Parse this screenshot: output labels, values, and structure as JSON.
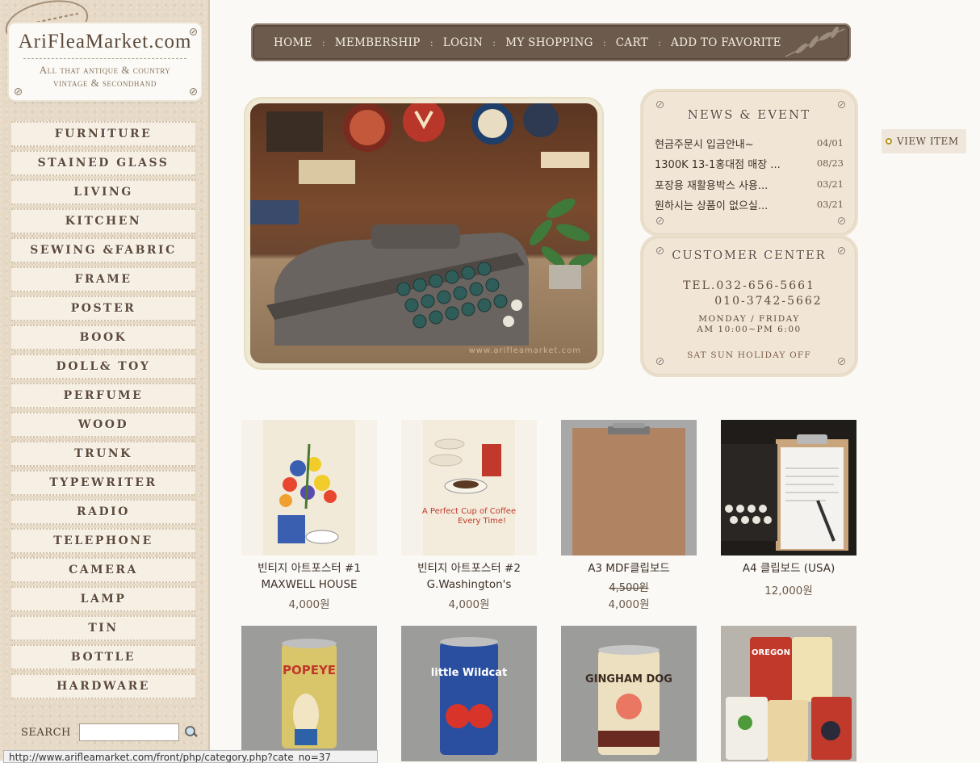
{
  "logo": {
    "title": "AriFleaMarket.com",
    "subtitle_1": "All that antique & country",
    "subtitle_2": "vintage & secondhand"
  },
  "categories": [
    "FURNITURE",
    "STAINED GLASS",
    "LIVING",
    "KITCHEN",
    "SEWING &FABRIC",
    "FRAME",
    "POSTER",
    "BOOK",
    "DOLL& TOY",
    "PERFUME",
    "WOOD",
    "TRUNK",
    "TYPEWRITER",
    "RADIO",
    "TELEPHONE",
    "CAMERA",
    "LAMP",
    "TIN",
    "BOTTLE",
    "HARDWARE"
  ],
  "search": {
    "label": "SEARCH",
    "value": ""
  },
  "nav": {
    "items": [
      "HOME",
      "MEMBERSHIP",
      "LOGIN",
      "MY SHOPPING",
      "CART",
      "ADD TO FAVORITE"
    ],
    "separator": ":"
  },
  "hero": {
    "watermark": "www.arifleamarket.com"
  },
  "news": {
    "title": "NEWS & EVENT",
    "items": [
      {
        "title": "현금주문시 입금안내~",
        "date": "04/01"
      },
      {
        "title": "1300K 13-1홍대점 매장 ...",
        "date": "08/23"
      },
      {
        "title": "포장용 재활용박스 사용...",
        "date": "03/21"
      },
      {
        "title": "원하시는 상품이 없으실...",
        "date": "03/21"
      }
    ]
  },
  "customer_center": {
    "title": "CUSTOMER CENTER",
    "tel_1": "TEL.032-656-5661",
    "tel_2": "010-3742-5662",
    "hours_1": "MONDAY / FRIDAY",
    "hours_2": "AM 10:00~PM 6:00",
    "holiday": "SAT SUN HOLIDAY OFF"
  },
  "view_item": {
    "label": "VIEW ITEM"
  },
  "products": [
    {
      "name_1": "빈티지 아트포스터 #1",
      "name_2": "MAXWELL HOUSE",
      "price": "4,000원",
      "old_price": ""
    },
    {
      "name_1": "빈티지 아트포스터 #2",
      "name_2": "G.Washington's",
      "price": "4,000원",
      "old_price": ""
    },
    {
      "name_1": "A3 MDF클립보드",
      "name_2": "",
      "price": "4,000원",
      "old_price": "4,500원"
    },
    {
      "name_1": "A4 클립보드 (USA)",
      "name_2": "",
      "price": "12,000원",
      "old_price": ""
    }
  ],
  "products_row2": [
    {
      "label": "POPEYE"
    },
    {
      "label": "little Wildcat"
    },
    {
      "label": "GINGHAM DOG"
    },
    {
      "label": "OREGON"
    }
  ],
  "statusbar": {
    "text": "http://www.arifleamarket.com/front/php/category.php?cate_no=37"
  },
  "colors": {
    "nav_bg": "#6c5b4d",
    "sidebar_bg": "#e6d9c6",
    "panel_bg": "#f1e6d6",
    "text_brown": "#5d4a3b"
  }
}
